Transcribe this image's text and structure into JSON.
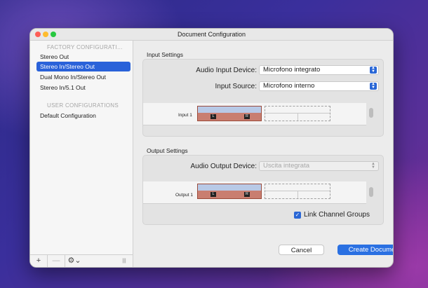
{
  "window": {
    "title": "Document Configuration"
  },
  "sidebar": {
    "factory_header": "FACTORY CONFIGURATI…",
    "factory_items": [
      "Stereo Out",
      "Stereo In/Stereo Out",
      "Dual Mono In/Stereo Out",
      "Stereo In/5.1 Out"
    ],
    "selected_index": 1,
    "user_header": "USER CONFIGURATIONS",
    "user_items": [
      "Default Configuration"
    ],
    "toolbar": {
      "add": "+",
      "remove": "—",
      "gear": "⚙⌄",
      "resize": "|||"
    }
  },
  "input": {
    "title": "Input Settings",
    "device_label": "Audio Input Device:",
    "device_value": "Microfono integrato",
    "source_label": "Input Source:",
    "source_value": "Microfono interno",
    "channel_label": "Input 1",
    "left_tag": "L",
    "right_tag": "R"
  },
  "output": {
    "title": "Output Settings",
    "device_label": "Audio Output Device:",
    "device_value": "Uscita integrata",
    "device_disabled": true,
    "channel_label": "Output 1",
    "left_tag": "L",
    "right_tag": "R",
    "link_label": "Link Channel Groups",
    "link_checked": true
  },
  "buttons": {
    "cancel": "Cancel",
    "create": "Create Document"
  },
  "colors": {
    "accent": "#2a70e2",
    "selection": "#2a62d9",
    "channel_fill": "#c97e70"
  },
  "icons": {
    "select_arrow": "up-down-chevron-icon",
    "checkbox": "checkmark-icon"
  }
}
